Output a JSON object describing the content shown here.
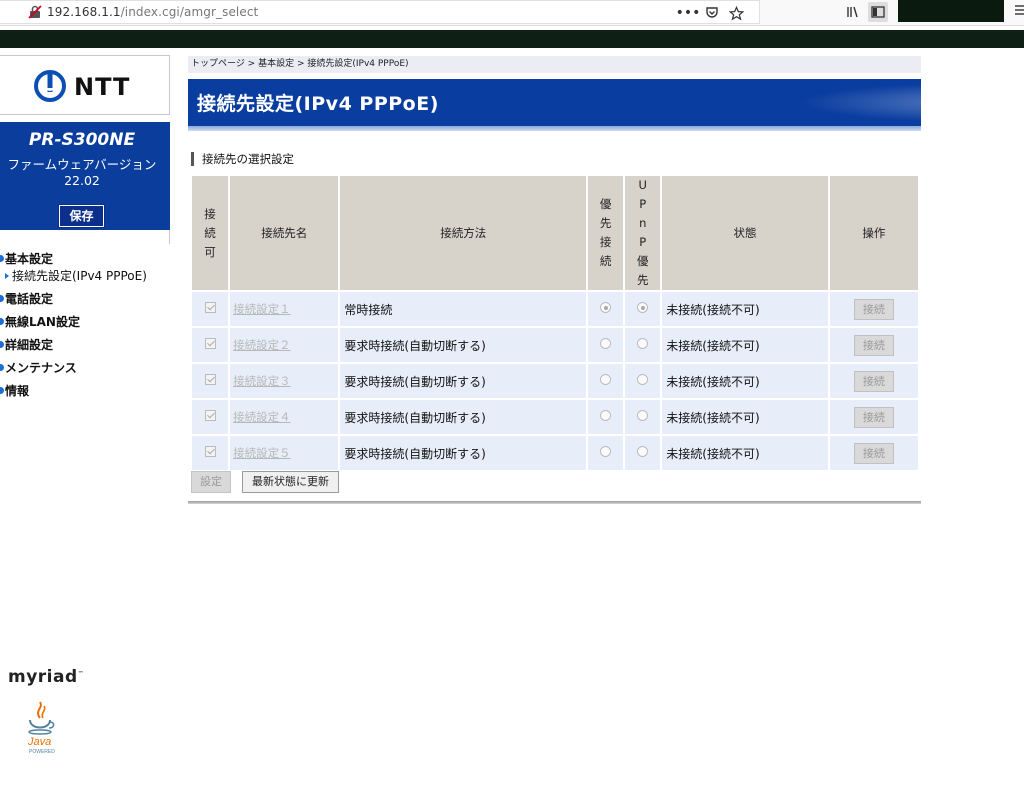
{
  "browser": {
    "url_host": "192.168.1.1",
    "url_path": "/index.cgi/amgr_select"
  },
  "sidebar": {
    "brand": "NTT",
    "model": "PR-S300NE",
    "firmware_label": "ファームウェアバージョン",
    "firmware_version": "22.02",
    "save_label": "保存",
    "nav": [
      {
        "label": "基本設定"
      },
      {
        "label": "接続先設定(IPv4 PPPoE)"
      },
      {
        "label": "電話設定"
      },
      {
        "label": "無線LAN設定"
      },
      {
        "label": "詳細設定"
      },
      {
        "label": "メンテナンス"
      },
      {
        "label": "情報"
      }
    ],
    "footer_logo": "myriad",
    "java_text": "Java",
    "java_sub": "POWERED"
  },
  "main": {
    "breadcrumb": "トップページ > 基本設定 > 接続先設定(IPv4 PPPoE)",
    "title": "接続先設定(IPv4 PPPoE)",
    "section": "接続先の選択設定",
    "columns": {
      "enable": "接続可",
      "name": "接続先名",
      "method": "接続方法",
      "priority": "優先接続",
      "upnp": "UPnP優先",
      "state": "状態",
      "action": "操作"
    },
    "rows": [
      {
        "name": "接続設定１",
        "method": "常時接続",
        "priority": true,
        "upnp": true,
        "state": "未接続(接続不可)",
        "action": "接続"
      },
      {
        "name": "接続設定２",
        "method": "要求時接続(自動切断する)",
        "priority": false,
        "upnp": false,
        "state": "未接続(接続不可)",
        "action": "接続"
      },
      {
        "name": "接続設定３",
        "method": "要求時接続(自動切断する)",
        "priority": false,
        "upnp": false,
        "state": "未接続(接続不可)",
        "action": "接続"
      },
      {
        "name": "接続設定４",
        "method": "要求時接続(自動切断する)",
        "priority": false,
        "upnp": false,
        "state": "未接続(接続不可)",
        "action": "接続"
      },
      {
        "name": "接続設定５",
        "method": "要求時接続(自動切断する)",
        "priority": false,
        "upnp": false,
        "state": "未接続(接続不可)",
        "action": "接続"
      }
    ],
    "set_button": "設定",
    "refresh_button": "最新状態に更新"
  }
}
